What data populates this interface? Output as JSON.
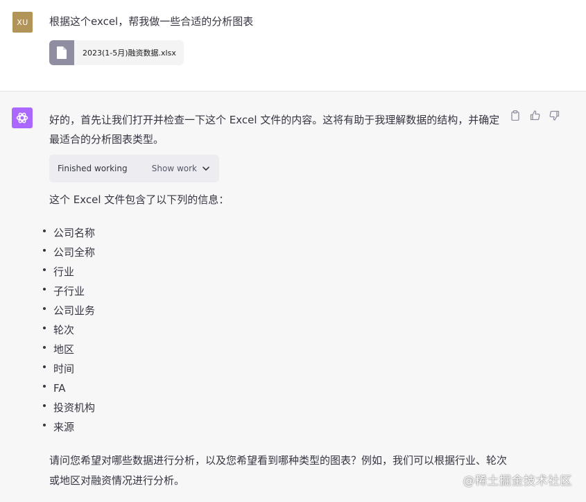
{
  "user": {
    "avatar_text": "XU",
    "message": "根据这个excel，帮我做一些合适的分析图表",
    "file_name": "2023(1-5月)融资数据.xlsx"
  },
  "assistant": {
    "intro": "好的，首先让我们打开并检查一下这个 Excel 文件的内容。这将有助于我理解数据的结构，并确定最适合的分析图表类型。",
    "work_status": "Finished working",
    "show_work_label": "Show work",
    "info_line": "这个 Excel 文件包含了以下列的信息：",
    "fields": [
      "公司名称",
      "公司全称",
      "行业",
      "子行业",
      "公司业务",
      "轮次",
      "地区",
      "时间",
      "FA",
      "投资机构",
      "来源"
    ],
    "question": "请问您希望对哪些数据进行分析，以及您希望看到哪种类型的图表？例如，我们可以根据行业、轮次或地区对融资情况进行分析。"
  },
  "watermark": "@稀土掘金技术社区",
  "icons": {
    "file": "file-icon",
    "bot": "openai-logo-icon",
    "copy": "clipboard-icon",
    "like": "thumbs-up-icon",
    "dislike": "thumbs-down-icon",
    "expand": "chevron-down-icon"
  },
  "colors": {
    "user_avatar": "#b29458",
    "bot_avatar": "#ab68ff",
    "assistant_bg": "#f7f7f8",
    "pill_bg": "#ececf1",
    "file_icon_bg": "#8e8ea0"
  }
}
